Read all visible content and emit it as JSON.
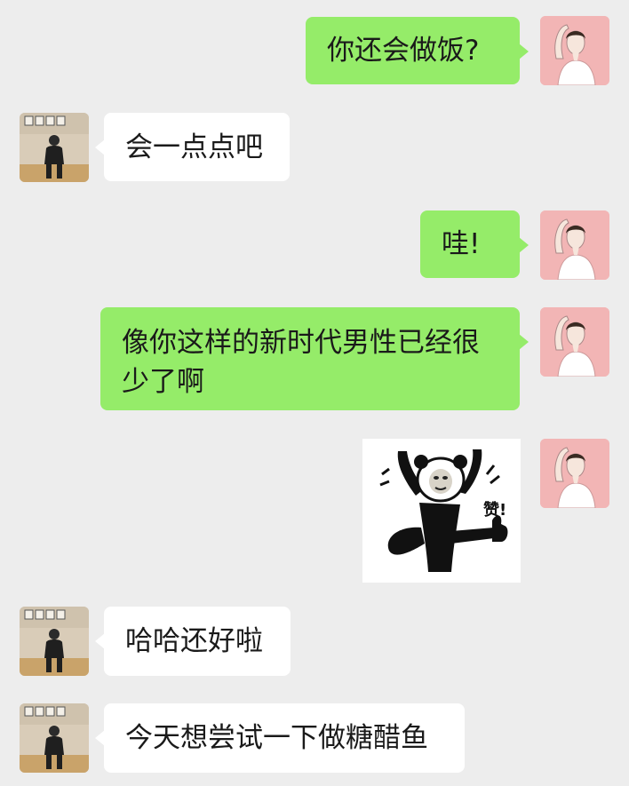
{
  "messages": [
    {
      "side": "right",
      "type": "text",
      "text": "你还会做饭?"
    },
    {
      "side": "left",
      "type": "text",
      "text": "会一点点吧"
    },
    {
      "side": "right",
      "type": "text",
      "text": "哇!"
    },
    {
      "side": "right",
      "type": "text",
      "text": "像你这样的新时代男性已经很少了啊"
    },
    {
      "side": "right",
      "type": "sticker",
      "sticker_caption": "赞!"
    },
    {
      "side": "left",
      "type": "text",
      "text": "哈哈还好啦"
    },
    {
      "side": "left",
      "type": "text",
      "text": "今天想尝试一下做糖醋鱼"
    }
  ],
  "colors": {
    "background": "#ededed",
    "self_bubble": "#95ec69",
    "other_bubble": "#ffffff",
    "text": "#1a1a1a"
  }
}
